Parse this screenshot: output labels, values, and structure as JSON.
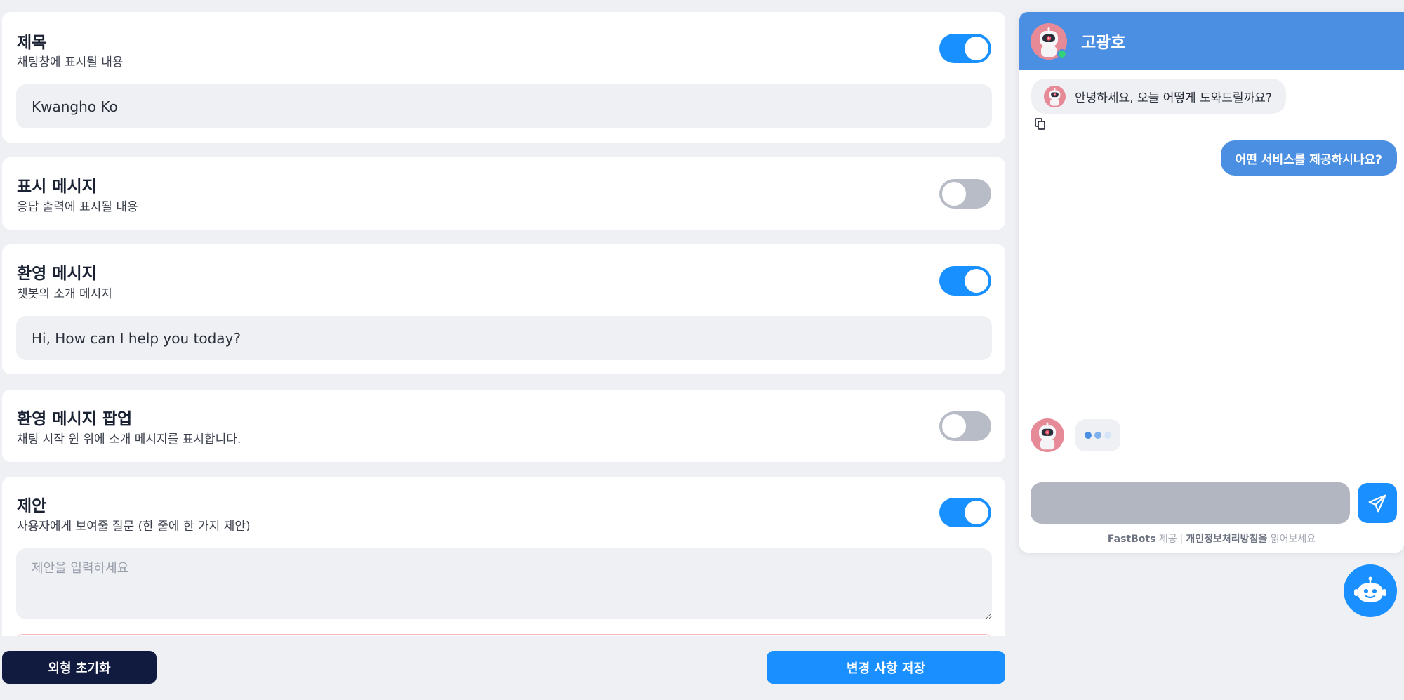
{
  "settings": {
    "title_card": {
      "title": "제목",
      "desc": "채팅창에 표시될 내용",
      "value": "Kwangho Ko",
      "enabled": true
    },
    "display_message": {
      "title": "표시 메시지",
      "desc": "응답 출력에 표시될 내용",
      "enabled": false
    },
    "welcome_message": {
      "title": "환영 메시지",
      "desc": "챗봇의 소개 메시지",
      "value": "Hi, How can I help you today?",
      "enabled": true
    },
    "welcome_popup": {
      "title": "환영 메시지 팝업",
      "desc": "채팅 시작 원 위에 소개 메시지를 표시합니다.",
      "enabled": false
    },
    "suggestions": {
      "title": "제안",
      "desc": "사용자에게 보여줄 질문 (한 줄에 한 가지 제안)",
      "placeholder": "제안을 입력하세요",
      "enabled": true
    }
  },
  "buttons": {
    "reset_label": "외형 초기화",
    "save_label": "변경 사항 저장"
  },
  "chat": {
    "header_name": "고광호",
    "bot_message": "안녕하세요, 오늘 어떻게 도와드릴까요?",
    "user_message": "어떤 서비스를 제공하시나요?",
    "input_value": "",
    "footer": {
      "brand": "FastBots",
      "provided": "제공",
      "separator": "|",
      "privacy": "개인정보처리방침을",
      "read": "읽어보세요"
    }
  },
  "colors": {
    "accent": "#1a8fff",
    "header": "#4a8fe2",
    "dark_button": "#111b3f",
    "toggle_off": "#b8bcc6"
  },
  "icons": [
    "copy-icon",
    "send-icon",
    "chatbot-launcher-icon",
    "robot-avatar-icon"
  ]
}
